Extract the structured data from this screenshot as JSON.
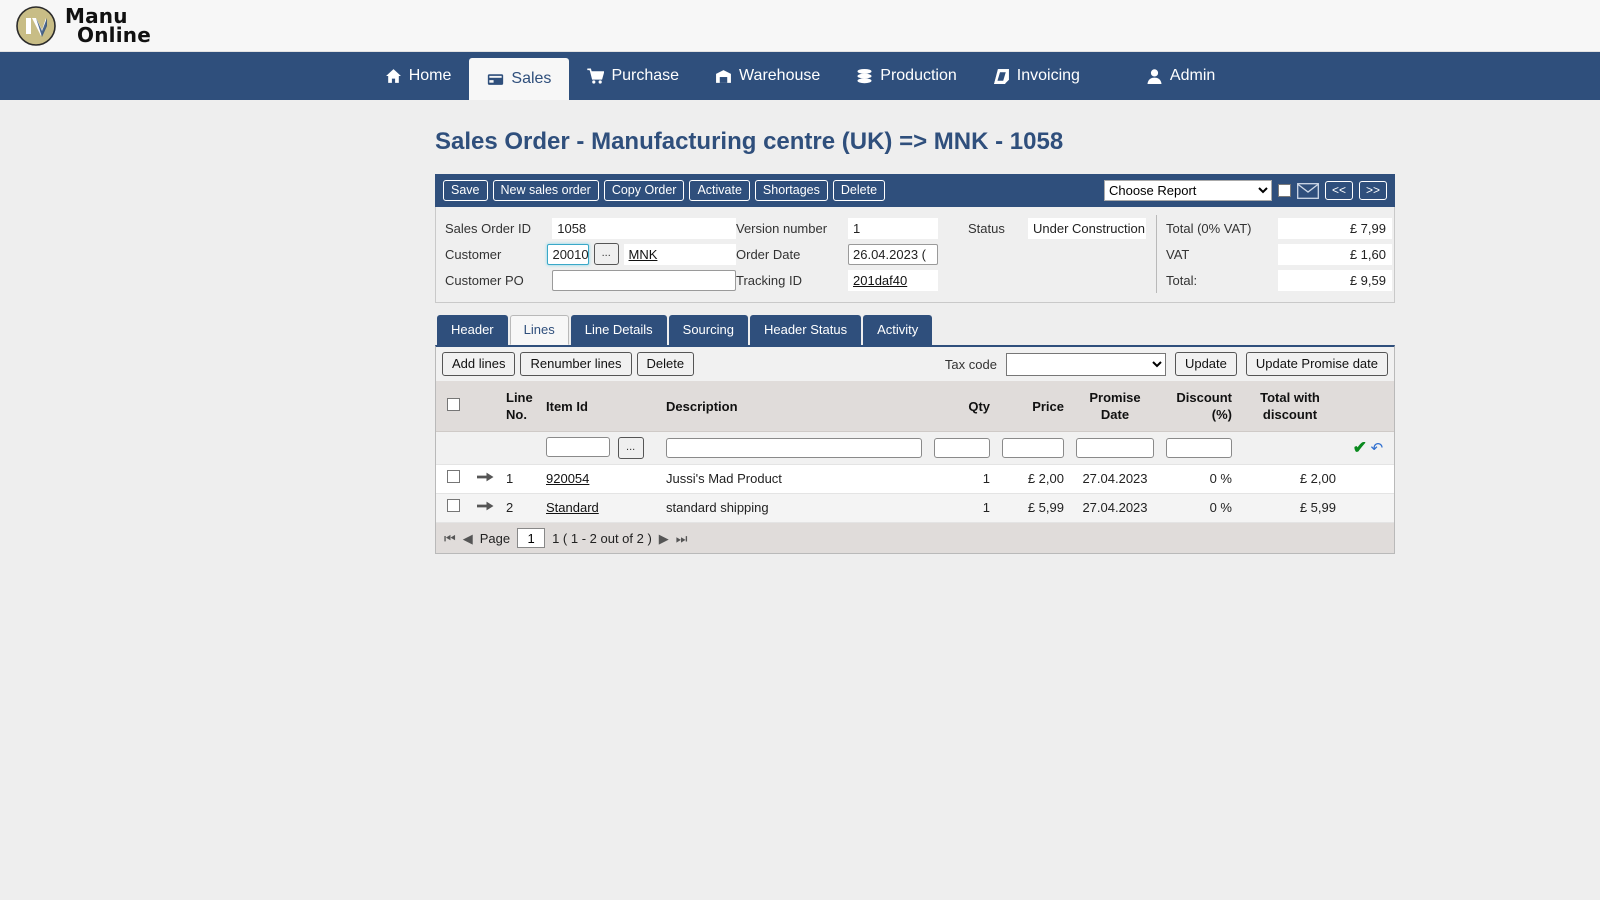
{
  "brand": {
    "line1": "Manu",
    "line2": "Online",
    "logo_gold": "#c8bd86",
    "nav_blue": "#2f4f7c"
  },
  "nav": {
    "items": [
      {
        "label": "Home",
        "icon": "home-icon",
        "active": false
      },
      {
        "label": "Sales",
        "icon": "card-icon",
        "active": true
      },
      {
        "label": "Purchase",
        "icon": "cart-icon",
        "active": false
      },
      {
        "label": "Warehouse",
        "icon": "warehouse-icon",
        "active": false
      },
      {
        "label": "Production",
        "icon": "stack-icon",
        "active": false
      },
      {
        "label": "Invoicing",
        "icon": "tag-icon",
        "active": false
      },
      {
        "label": "Admin",
        "icon": "user-icon",
        "active": false
      }
    ]
  },
  "page_title": "Sales Order - Manufacturing centre (UK) => MNK - 1058",
  "toolbar": {
    "buttons": [
      "Save",
      "New sales order",
      "Copy Order",
      "Activate",
      "Shortages",
      "Delete"
    ],
    "report_select": "Choose Report",
    "mail_icon": "envelope-icon",
    "prev_label": "<<",
    "next_label": ">>"
  },
  "header_fields": {
    "sales_order_id": {
      "label": "Sales Order ID",
      "value": "1058"
    },
    "customer": {
      "label": "Customer",
      "code": "20010",
      "lookup": "...",
      "name": "MNK"
    },
    "customer_po": {
      "label": "Customer PO",
      "value": ""
    },
    "version_number": {
      "label": "Version number",
      "value": "1"
    },
    "order_date": {
      "label": "Order Date",
      "value": "26.04.2023 ("
    },
    "tracking_id": {
      "label": "Tracking ID",
      "value": "201daf40"
    },
    "status": {
      "label": "Status",
      "value": "Under Construction"
    }
  },
  "totals": [
    {
      "label": "Total (0% VAT)",
      "value": "£ 7,99"
    },
    {
      "label": "VAT",
      "value": "£ 1,60"
    },
    {
      "label": "Total:",
      "value": "£ 9,59"
    }
  ],
  "tabs": [
    {
      "label": "Header",
      "active": false
    },
    {
      "label": "Lines",
      "active": true
    },
    {
      "label": "Line Details",
      "active": false
    },
    {
      "label": "Sourcing",
      "active": false
    },
    {
      "label": "Header Status",
      "active": false
    },
    {
      "label": "Activity",
      "active": false
    }
  ],
  "grid_toolbar": {
    "add_lines": "Add lines",
    "renumber_lines": "Renumber lines",
    "delete": "Delete",
    "tax_code_label": "Tax code",
    "tax_code_value": "",
    "update": "Update",
    "update_promise_date": "Update Promise date"
  },
  "table": {
    "columns": [
      "",
      "",
      "Line No.",
      "Item Id",
      "Description",
      "Qty",
      "Price",
      "Promise Date",
      "Discount (%)",
      "Total with discount",
      ""
    ],
    "columns_split": {
      "line_no_a": "Line",
      "line_no_b": "No.",
      "promise_a": "Promise",
      "promise_b": "Date",
      "discount_a": "Discount",
      "discount_b": "(%)",
      "total_a": "Total with",
      "total_b": "discount",
      "item_id": "Item Id",
      "description": "Description",
      "qty": "Qty",
      "price": "Price"
    },
    "filter_row": {
      "item_id": "",
      "lookup": "...",
      "description": "",
      "qty": "",
      "price": "",
      "promise_date": "",
      "discount": "",
      "confirm_icon": "check-icon",
      "revert_icon": "undo-arrow-icon"
    },
    "rows": [
      {
        "line_no": "1",
        "item_id": "920054",
        "description": "Jussi's Mad Product",
        "qty": "1",
        "price": "£ 2,00",
        "promise_date": "27.04.2023",
        "discount": "0 %",
        "total": "£ 2,00"
      },
      {
        "line_no": "2",
        "item_id": "Standard",
        "description": "standard shipping",
        "qty": "1",
        "price": "£ 5,99",
        "promise_date": "27.04.2023",
        "discount": "0 %",
        "total": "£ 5,99"
      }
    ]
  },
  "pager": {
    "first_icon": "first-page-icon",
    "prev_icon": "prev-page-icon",
    "page_label": "Page",
    "page_value": "1",
    "summary": "1 ( 1 - 2 out of 2 )",
    "next_icon": "next-page-icon",
    "last_icon": "last-page-icon"
  }
}
